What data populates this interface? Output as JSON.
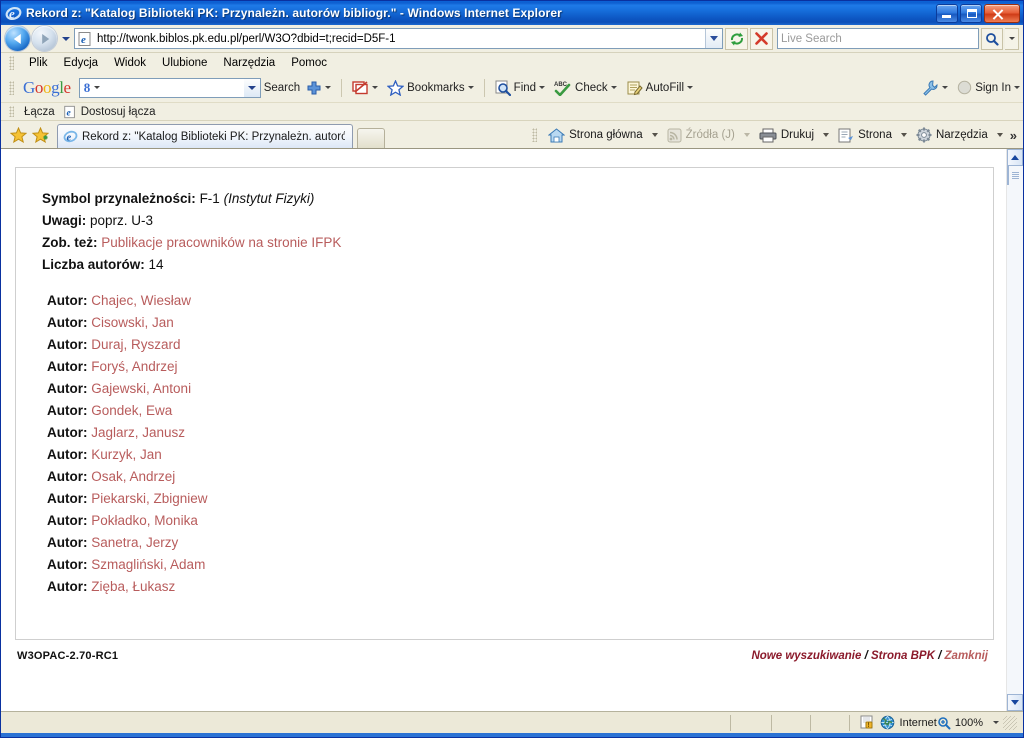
{
  "window": {
    "title": "Rekord z: \"Katalog Biblioteki PK: Przynależn. autorów bibliogr.\" - Windows Internet Explorer",
    "controls": {
      "minimize": "Minimalizuj",
      "maximize": "Maksymalizuj",
      "close": "Zamknij"
    }
  },
  "addressbar": {
    "url": "http://twonk.biblos.pk.edu.pl/perl/W3O?dbid=t;recid=D5F-1",
    "back_tooltip": "Wstecz",
    "forward_tooltip": "Dalej",
    "refresh_tooltip": "Odśwież",
    "stop_tooltip": "Zatrzymaj",
    "search_placeholder": "Live Search"
  },
  "menubar": {
    "items": [
      {
        "label": "Plik",
        "accel": "P"
      },
      {
        "label": "Edycja",
        "accel": "E"
      },
      {
        "label": "Widok",
        "accel": "W"
      },
      {
        "label": "Ulubione",
        "accel": "U"
      },
      {
        "label": "Narzędzia",
        "accel": "N"
      },
      {
        "label": "Pomoc",
        "accel": "c"
      }
    ]
  },
  "google_toolbar": {
    "logo": "Google",
    "search_value": "",
    "search_button": "Search",
    "items": [
      {
        "label": "Bookmarks",
        "icon": "star-icon"
      },
      {
        "label": "Find",
        "icon": "find-icon"
      },
      {
        "label": "Check",
        "icon": "spellcheck-icon"
      },
      {
        "label": "AutoFill",
        "icon": "autofill-icon"
      }
    ],
    "settings_icon": "wrench-icon",
    "signin": "Sign In"
  },
  "linksbar": {
    "label": "Łącza",
    "item": "Dostosuj łącza"
  },
  "tabbar": {
    "tab_title": "Rekord z: \"Katalog Biblioteki PK: Przynależn. autorów ...",
    "new_tab_tooltip": "Nowa karta",
    "commands": [
      {
        "label": "Strona główna",
        "icon": "home-icon",
        "disabled": false,
        "has_caret": true
      },
      {
        "label": "Źródła (J)",
        "icon": "rss-icon",
        "disabled": true,
        "has_caret": true
      },
      {
        "label": "Drukuj",
        "icon": "printer-icon",
        "disabled": false,
        "has_caret": true
      },
      {
        "label": "Strona",
        "icon": "page-icon",
        "disabled": false,
        "has_caret": true
      },
      {
        "label": "Narzędzia",
        "icon": "gear-icon",
        "disabled": false,
        "has_caret": true
      }
    ],
    "overflow": "»"
  },
  "record": {
    "fields": [
      {
        "label": "Symbol przynależności:",
        "value": "F-1",
        "value_italic": "(Instytut Fizyki)",
        "is_link": false
      },
      {
        "label": "Uwagi:",
        "value": "poprz. U-3",
        "value_italic": "",
        "is_link": false
      },
      {
        "label": "Zob. też:",
        "value": "Publikacje pracowników na stronie IFPK",
        "value_italic": "",
        "is_link": true
      },
      {
        "label": "Liczba autorów:",
        "value": "14",
        "value_italic": "",
        "is_link": false
      }
    ],
    "author_label": "Autor:",
    "authors": [
      "Chajec, Wiesław",
      "Cisowski, Jan",
      "Duraj, Ryszard",
      "Foryś, Andrzej",
      "Gajewski, Antoni",
      "Gondek, Ewa",
      "Jaglarz, Janusz",
      "Kurzyk, Jan",
      "Osak, Andrzej",
      "Piekarski, Zbigniew",
      "Pokładko, Monika",
      "Sanetra, Jerzy",
      "Szmagliński, Adam",
      "Zięba, Łukasz"
    ],
    "footer_version": "W3OPAC-2.70-RC1",
    "footer_links": [
      {
        "label": "Nowe wyszukiwanie",
        "dim": false
      },
      {
        "label": "Strona BPK",
        "dim": false
      },
      {
        "label": "Zamknij",
        "dim": true
      }
    ],
    "footer_separator": "/"
  },
  "statusbar": {
    "message": "",
    "zone": "Internet",
    "zone_icon": "globe-icon",
    "zoom": "100%"
  },
  "colors": {
    "titlebar_blue": "#0e5fd0",
    "link_red": "#b85c5c",
    "footer_red": "#8b1a2b",
    "chrome_beige": "#f1efe2",
    "content_white": "#ffffff"
  }
}
